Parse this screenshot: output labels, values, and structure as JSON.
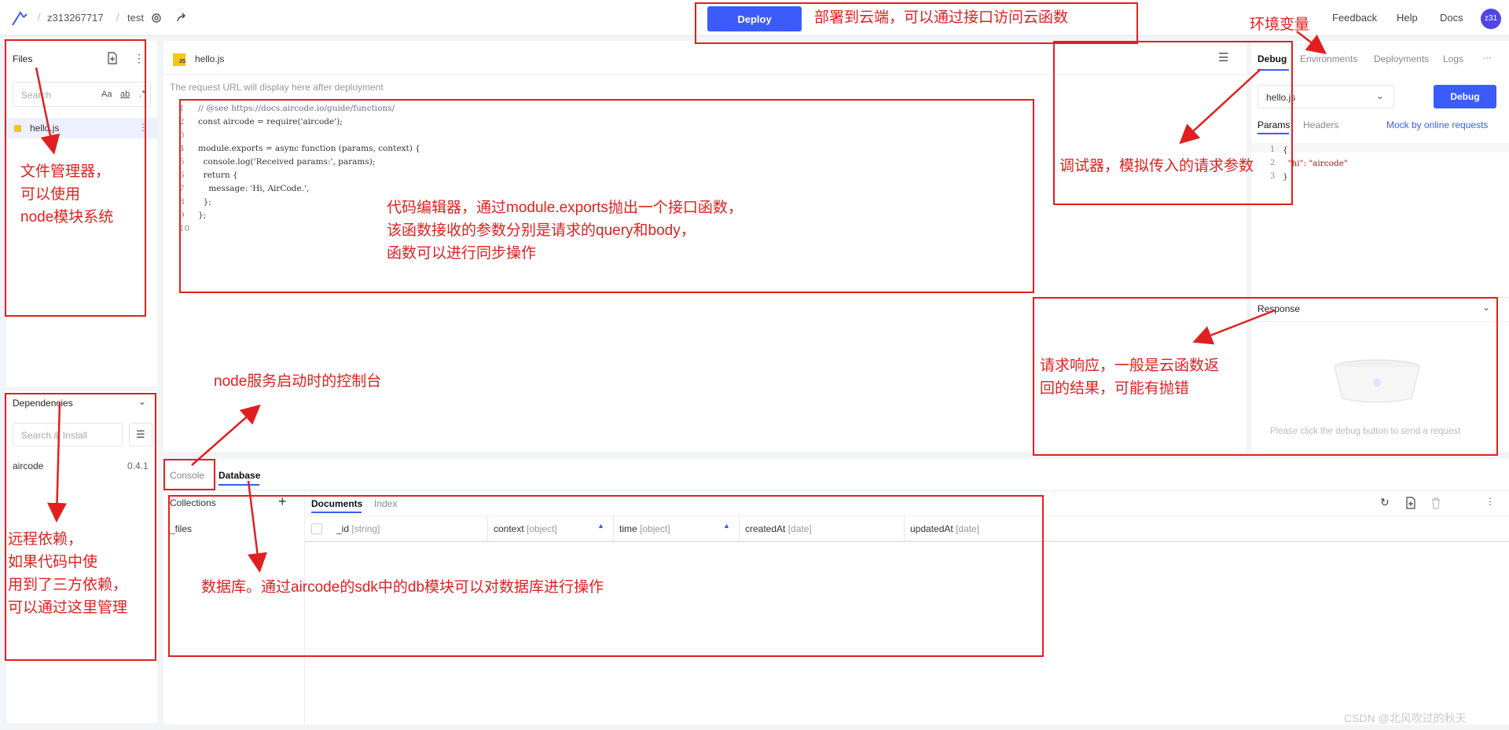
{
  "topbar": {
    "user": "z313267717",
    "project": "test",
    "deploy_label": "Deploy",
    "links": [
      "Feedback",
      "Help",
      "Docs"
    ],
    "avatar": "z31"
  },
  "files": {
    "title": "Files",
    "search_placeholder": "Search",
    "opt_case": "Aa",
    "opt_word": "ab",
    "opt_regex": ".*",
    "file_name": "hello.js"
  },
  "dependencies": {
    "title": "Dependencies",
    "search_placeholder": "Search & Install",
    "items": [
      {
        "name": "aircode",
        "version": "0.4.1"
      }
    ]
  },
  "editor": {
    "tab_icon": "JS",
    "tab_name": "hello.js",
    "url_hint": "The request URL will display here after deployment",
    "lines": [
      "// @see https://docs.aircode.io/guide/functions/",
      "const aircode = require('aircode');",
      "",
      "module.exports = async function (params, context) {",
      "  console.log('Received params:', params);",
      "  return {",
      "    message: 'Hi, AirCode.',",
      "  };",
      "};",
      ""
    ]
  },
  "debug": {
    "tabs": [
      "Debug",
      "Environments",
      "Deployments",
      "Logs"
    ],
    "more": "···",
    "file_select": "hello.js",
    "debug_button": "Debug",
    "subtabs": [
      "Params",
      "Headers"
    ],
    "mock_link": "Mock by online requests",
    "params_lines": [
      "{",
      "  \"hi\": \"aircode\"",
      "}"
    ]
  },
  "response": {
    "title": "Response",
    "empty_text": "Please click the debug button to send a request"
  },
  "bottom": {
    "tabs": [
      "Console",
      "Database"
    ],
    "collections_title": "Collections",
    "collections": [
      "_files"
    ],
    "db_tabs": [
      "Documents",
      "Index"
    ],
    "columns": [
      {
        "name": "_id",
        "type": "[string]"
      },
      {
        "name": "context",
        "type": "[object]"
      },
      {
        "name": "time",
        "type": "[object]"
      },
      {
        "name": "createdAt",
        "type": "[date]"
      },
      {
        "name": "updatedAt",
        "type": "[date]"
      }
    ]
  },
  "annotations": {
    "deploy": "部署到云端，可以通过接口访问云函数",
    "env": "环境变量",
    "files": "文件管理器，\n可以使用\nnode模块系统",
    "editor": "代码编辑器，通过module.exports抛出一个接口函数，\n该函数接收的参数分别是请求的query和body，\n函数可以进行同步操作",
    "debugger": "调试器，模拟传入的请求参数",
    "response": "请求响应，一般是云函数返\n回的结果，可能有抛错",
    "console": "node服务启动时的控制台",
    "deps": "远程依赖，\n如果代码中使\n用到了三方依赖，\n可以通过这里管理",
    "db": "数据库。通过aircode的sdk中的db模块可以对数据库进行操作"
  },
  "watermark": "CSDN @北风吹过的秋天"
}
